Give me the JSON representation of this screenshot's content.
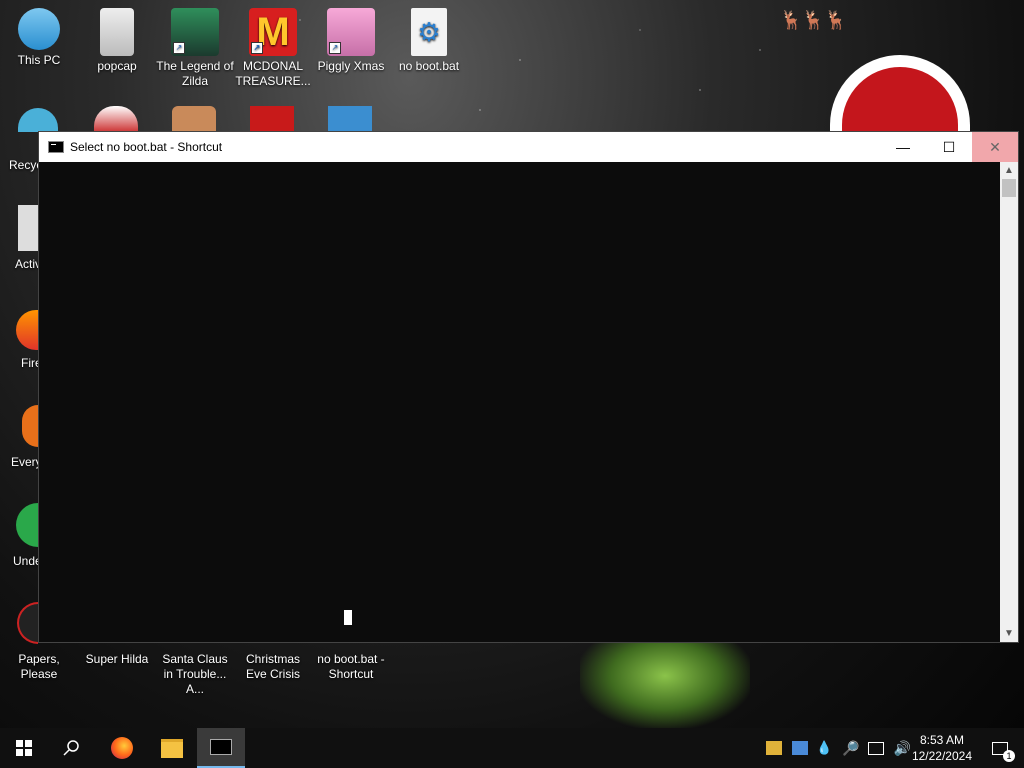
{
  "desktop": {
    "icons_row1": [
      {
        "label": "This PC"
      },
      {
        "label": "popcap"
      },
      {
        "label": "The Legend of Zilda"
      },
      {
        "label": "MCDONAL TREASURE..."
      },
      {
        "label": "Piggly Xmas"
      },
      {
        "label": "no boot.bat"
      }
    ],
    "left_edge_labels": [
      "Recyc",
      "Activ",
      "Fire",
      "Every",
      "Unde"
    ],
    "icons_bottom": [
      {
        "label": "Papers, Please"
      },
      {
        "label": "Super Hilda"
      },
      {
        "label": "Santa Claus in Trouble... A..."
      },
      {
        "label": "Christmas Eve Crisis"
      },
      {
        "label": "no boot.bat - Shortcut"
      }
    ]
  },
  "window": {
    "title": "Select no boot.bat - Shortcut",
    "minimize_glyph": "—",
    "maximize_glyph": "☐",
    "close_glyph": "✕",
    "scroll_up": "▲",
    "scroll_down": "▼"
  },
  "taskbar": {
    "time": "8:53 AM",
    "date": "12/22/2024",
    "notification_count": "1",
    "pinned": [
      "windows-start-icon",
      "search-icon",
      "firefox-icon",
      "file-explorer-icon",
      "command-prompt-icon"
    ],
    "tray": [
      "tray-app-icon",
      "tray-network-user-icon",
      "tray-drop-icon",
      "tray-search-icon",
      "network-icon",
      "volume-icon"
    ]
  },
  "colors": {
    "console_bg": "#0c0c0c",
    "close_hover": "#f1a7ab",
    "taskbar": "#101010",
    "active_indicator": "#76b9ed"
  }
}
